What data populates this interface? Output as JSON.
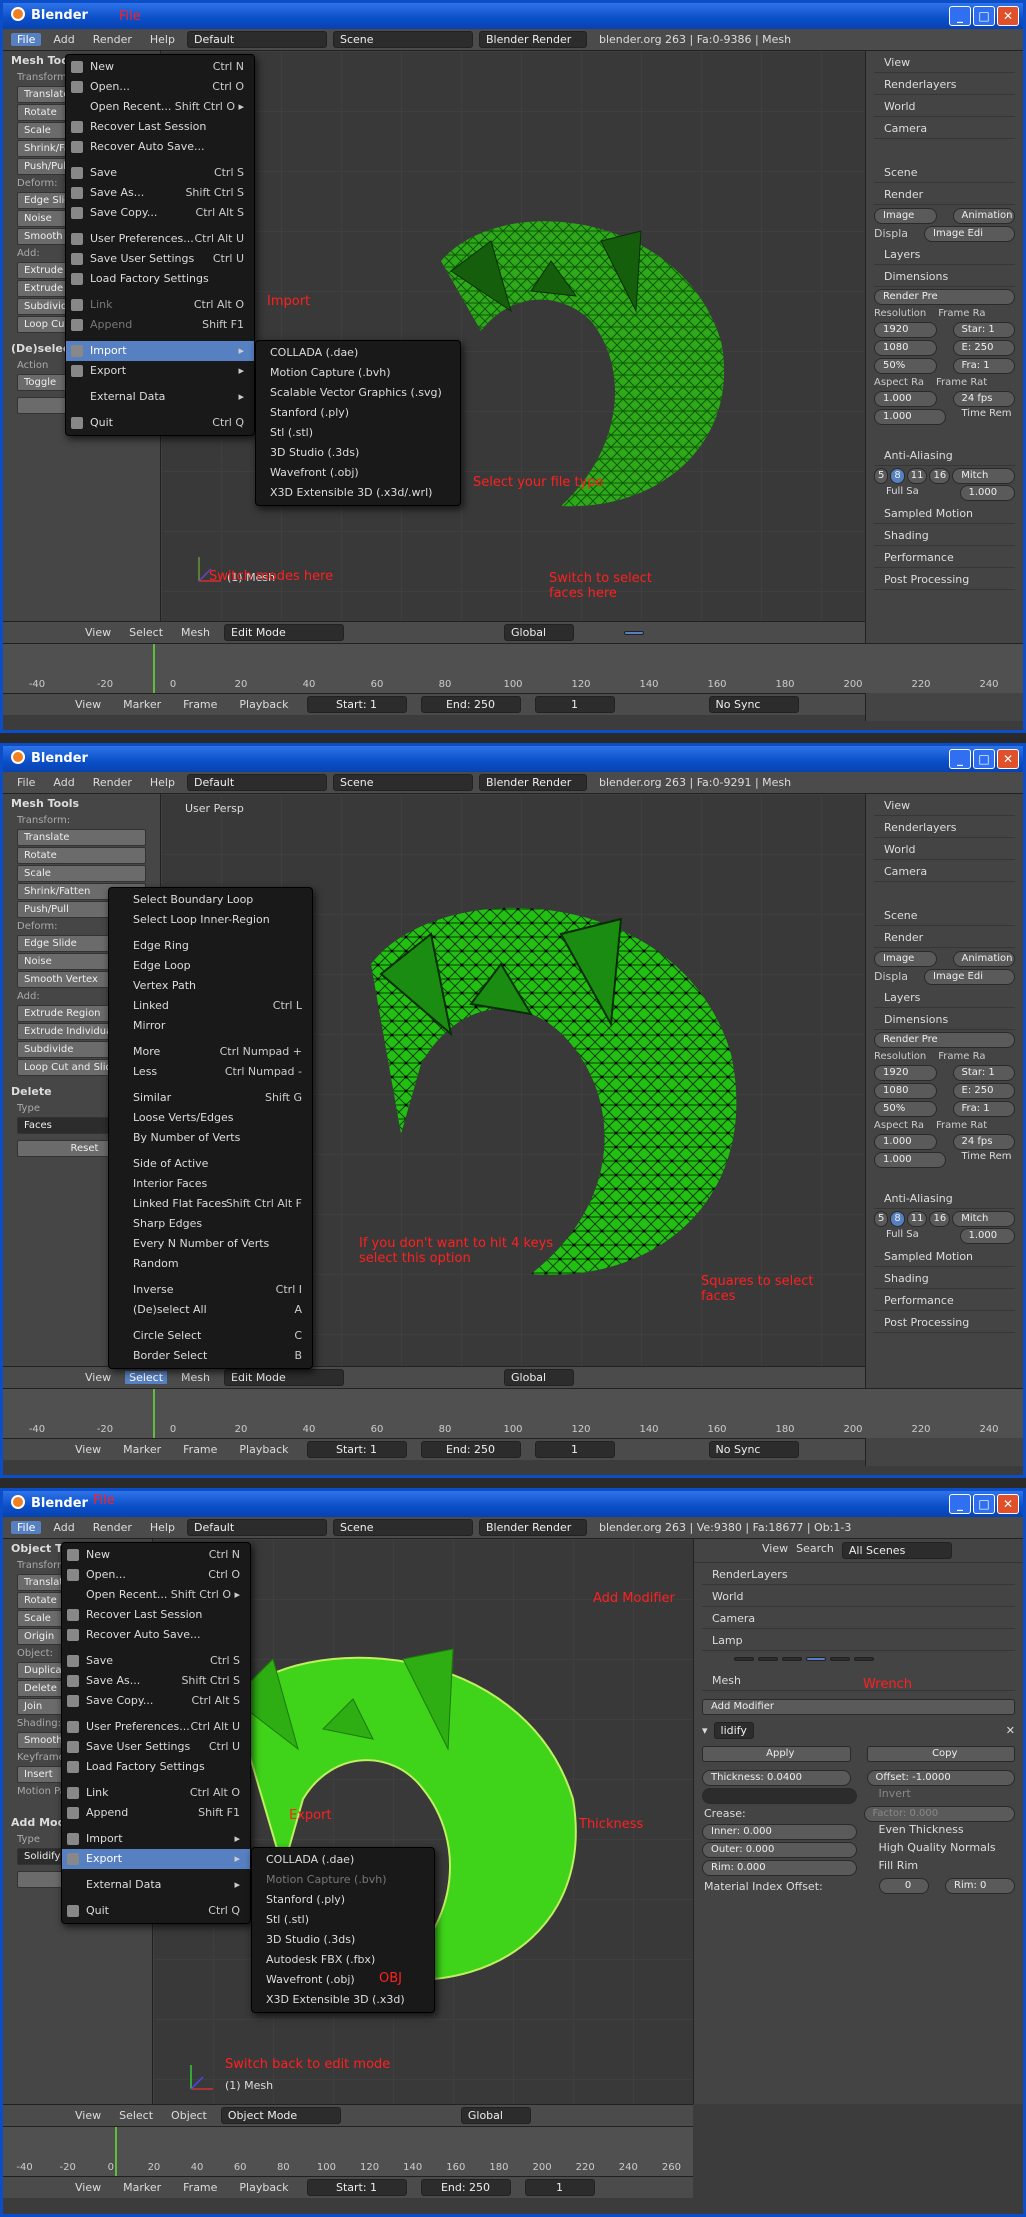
{
  "window": {
    "title": "Blender",
    "min": "_",
    "max": "□",
    "close": "✕"
  },
  "infobar": {
    "menus": [
      "File",
      "Add",
      "Render",
      "Help"
    ],
    "layout": "Default",
    "scene": "Scene",
    "engine": "Blender Render",
    "status1": "blender.org 263 | Fa:0-9386 | Mesh",
    "status2": "blender.org 263 | Fa:0-9291 | Mesh",
    "status3": "blender.org 263 | Ve:9380 | Fa:18677 | Ob:1-3"
  },
  "tool1": {
    "header": "Mesh Tools",
    "sections": [
      "Transform:",
      "Deform:",
      "Add:",
      "(De)select"
    ],
    "transform": [
      "Translate",
      "Rotate",
      "Scale",
      "Shrink/Fatten",
      "Push/Pull"
    ],
    "deform": [
      "Edge Slide",
      "Noise",
      "Smooth Vertex"
    ],
    "add": [
      "Extrude Region",
      "Extrude Individual",
      "Subdivide",
      "Loop Cut and Slide"
    ],
    "action_label": "Action",
    "action_value": "Toggle",
    "reset": "Reset"
  },
  "tool2": {
    "header": "Mesh Tools",
    "transform_label": "Transform:",
    "transform": [
      "Translate",
      "Rotate",
      "Scale",
      "Shrink/Fatten",
      "Push/Pull"
    ],
    "deform_label": "Deform:",
    "deform": [
      "Edge Slide",
      "Noise",
      "Smooth Vertex"
    ],
    "add_label": "Add:",
    "add": [
      "Extrude Region",
      "Extrude Individual",
      "Subdivide",
      "Loop Cut and Slide"
    ],
    "delete_label": "Delete",
    "type_label": "Type",
    "type_value": "Faces",
    "reset": "Reset"
  },
  "tool3": {
    "header": "Object Tools",
    "transform_label": "Transform:",
    "transform": [
      "Translate",
      "Rotate",
      "Scale",
      "Origin"
    ],
    "object_label": "Object:",
    "object": [
      "Duplicate",
      "Delete",
      "Join"
    ],
    "shading_label": "Shading:",
    "shading": [
      "Smooth"
    ],
    "keyframes_label": "Keyframes:",
    "keyframes": [
      "Insert"
    ],
    "motion_label": "Motion Paths:",
    "addmod_label": "Add Modifier",
    "type_label": "Type",
    "type_value": "Solidify",
    "reset": "Reset"
  },
  "viewport": {
    "persp": "User Persp",
    "objlabel": "(1) Mesh"
  },
  "file_menu": [
    {
      "label": "New",
      "sc": "Ctrl N"
    },
    {
      "label": "Open...",
      "sc": "Ctrl O"
    },
    {
      "label": "Open Recent...",
      "sc": "Shift Ctrl O ▸"
    },
    {
      "label": "Recover Last Session",
      "sc": ""
    },
    {
      "label": "Recover Auto Save...",
      "sc": ""
    },
    {
      "label": "Save",
      "sc": "Ctrl S"
    },
    {
      "label": "Save As...",
      "sc": "Shift Ctrl S"
    },
    {
      "label": "Save Copy...",
      "sc": "Ctrl Alt S"
    },
    {
      "label": "User Preferences...",
      "sc": "Ctrl Alt U"
    },
    {
      "label": "Save User Settings",
      "sc": "Ctrl U"
    },
    {
      "label": "Load Factory Settings",
      "sc": ""
    },
    {
      "label": "Link",
      "sc": "Ctrl Alt O"
    },
    {
      "label": "Append",
      "sc": "Shift F1"
    },
    {
      "label": "Import",
      "sc": "▸"
    },
    {
      "label": "Export",
      "sc": "▸"
    },
    {
      "label": "External Data",
      "sc": "▸"
    },
    {
      "label": "Quit",
      "sc": "Ctrl Q"
    }
  ],
  "import_submenu": [
    "COLLADA (.dae)",
    "Motion Capture (.bvh)",
    "Scalable Vector Graphics (.svg)",
    "Stanford (.ply)",
    "Stl (.stl)",
    "3D Studio (.3ds)",
    "Wavefront (.obj)",
    "X3D Extensible 3D (.x3d/.wrl)"
  ],
  "export_submenu": [
    "COLLADA (.dae)",
    "Motion Capture (.bvh)",
    "Stanford (.ply)",
    "Stl (.stl)",
    "3D Studio (.3ds)",
    "Autodesk FBX (.fbx)",
    "Wavefront (.obj)",
    "X3D Extensible 3D (.x3d)"
  ],
  "select_menu": [
    {
      "label": "Select Boundary Loop",
      "sc": ""
    },
    {
      "label": "Select Loop Inner-Region",
      "sc": ""
    },
    {
      "label": "Edge Ring",
      "sc": ""
    },
    {
      "label": "Edge Loop",
      "sc": ""
    },
    {
      "label": "Vertex Path",
      "sc": ""
    },
    {
      "label": "Linked",
      "sc": "Ctrl L"
    },
    {
      "label": "Mirror",
      "sc": ""
    },
    {
      "label": "More",
      "sc": "Ctrl Numpad +"
    },
    {
      "label": "Less",
      "sc": "Ctrl Numpad -"
    },
    {
      "label": "Similar",
      "sc": "Shift G"
    },
    {
      "label": "Loose Verts/Edges",
      "sc": ""
    },
    {
      "label": "By Number of Verts",
      "sc": ""
    },
    {
      "label": "Side of Active",
      "sc": ""
    },
    {
      "label": "Interior Faces",
      "sc": ""
    },
    {
      "label": "Linked Flat Faces",
      "sc": "Shift Ctrl Alt F"
    },
    {
      "label": "Sharp Edges",
      "sc": ""
    },
    {
      "label": "Every N Number of Verts",
      "sc": ""
    },
    {
      "label": "Random",
      "sc": ""
    },
    {
      "label": "Inverse",
      "sc": "Ctrl I"
    },
    {
      "label": "(De)select All",
      "sc": "A"
    },
    {
      "label": "Circle Select",
      "sc": "C"
    },
    {
      "label": "Border Select",
      "sc": "B"
    }
  ],
  "props": {
    "outliner": [
      "View",
      "Search",
      "Renderlayers",
      "World",
      "Camera"
    ],
    "scene": "Scene",
    "render": "Render",
    "image": "Image",
    "animation": "Animation",
    "display_label": "Displa",
    "display_value": "Image Edi",
    "layers": "Layers",
    "dimensions": "Dimensions",
    "preset": "Render Pre",
    "resolution": "Resolution",
    "res_x": "1920",
    "res_y": "1080",
    "res_pct": "50%",
    "frame_range": "Frame Ra",
    "start": "Star: 1",
    "end": "E: 250",
    "frame": "Fra: 1",
    "aspect": "Aspect Ra",
    "asp_x": "1.000",
    "asp_y": "1.000",
    "framerate": "Frame Rat",
    "fps": "24 fps",
    "timerem": "Time Rem",
    "aa": "Anti-Aliasing",
    "aa_samples": [
      "5",
      "8",
      "11",
      "16"
    ],
    "aa_filter": "Mitch",
    "fullsample": "Full Sa",
    "aa_size": "1.000",
    "sampled": "Sampled Motion",
    "shading": "Shading",
    "performance": "Performance",
    "post": "Post Processing"
  },
  "props3": {
    "outliner_view": "View",
    "outliner_search": "Search",
    "outliner_scope": "All Scenes",
    "items": [
      "RenderLayers",
      "World",
      "Camera",
      "Lamp"
    ],
    "mesh": "Mesh",
    "add_modifier": "Add Modifier",
    "mod_name": "lidify",
    "apply": "Apply",
    "copy": "Copy",
    "thickness": "Thickness: 0.0400",
    "offset": "Offset: -1.0000",
    "invert": "Invert",
    "crease": "Crease:",
    "factor": "Factor: 0.000",
    "inner": "Inner: 0.000",
    "outer": "Outer: 0.000",
    "rim": "Rim: 0.000",
    "even": "Even Thickness",
    "hq": "High Quality Normals",
    "fillrim": "Fill Rim",
    "matidx": "Material Index Offset:",
    "mat_val": "0",
    "rim_val": "Rim: 0"
  },
  "hdr": {
    "view": "View",
    "select": "Select",
    "mesh": "Mesh",
    "object": "Object",
    "editmode": "Edit Mode",
    "objectmode": "Object Mode",
    "global": "Global"
  },
  "timeline": {
    "ticks": [
      "-40",
      "-20",
      "0",
      "20",
      "40",
      "60",
      "80",
      "100",
      "120",
      "140",
      "160",
      "180",
      "200",
      "220",
      "240",
      "260"
    ],
    "view": "View",
    "marker": "Marker",
    "frame": "Frame",
    "playback": "Playback",
    "start": "Start: 1",
    "end": "End: 250",
    "current": "1",
    "sync": "No Sync"
  },
  "annotations": {
    "file1": "File",
    "import": "Import",
    "filetype": "Select your file type",
    "switchmodes": "Switch modes here",
    "switchfaces": "Switch to select faces here",
    "hit4keys": "If you don't want to hit 4 keys select this option",
    "squares": "Squares to select faces",
    "file3": "File",
    "export": "Export",
    "obj": "OBJ",
    "addmod": "Add Modifier",
    "wrench": "Wrench",
    "thickness": "Thickness",
    "switchback": "Switch back to edit mode"
  },
  "colors": {
    "mesh_wire": "#1a8c12",
    "mesh_solid": "#3fd41a",
    "accent": "#5680c2",
    "anno": "#ff2020",
    "titlebar": "#0a4fc8"
  }
}
